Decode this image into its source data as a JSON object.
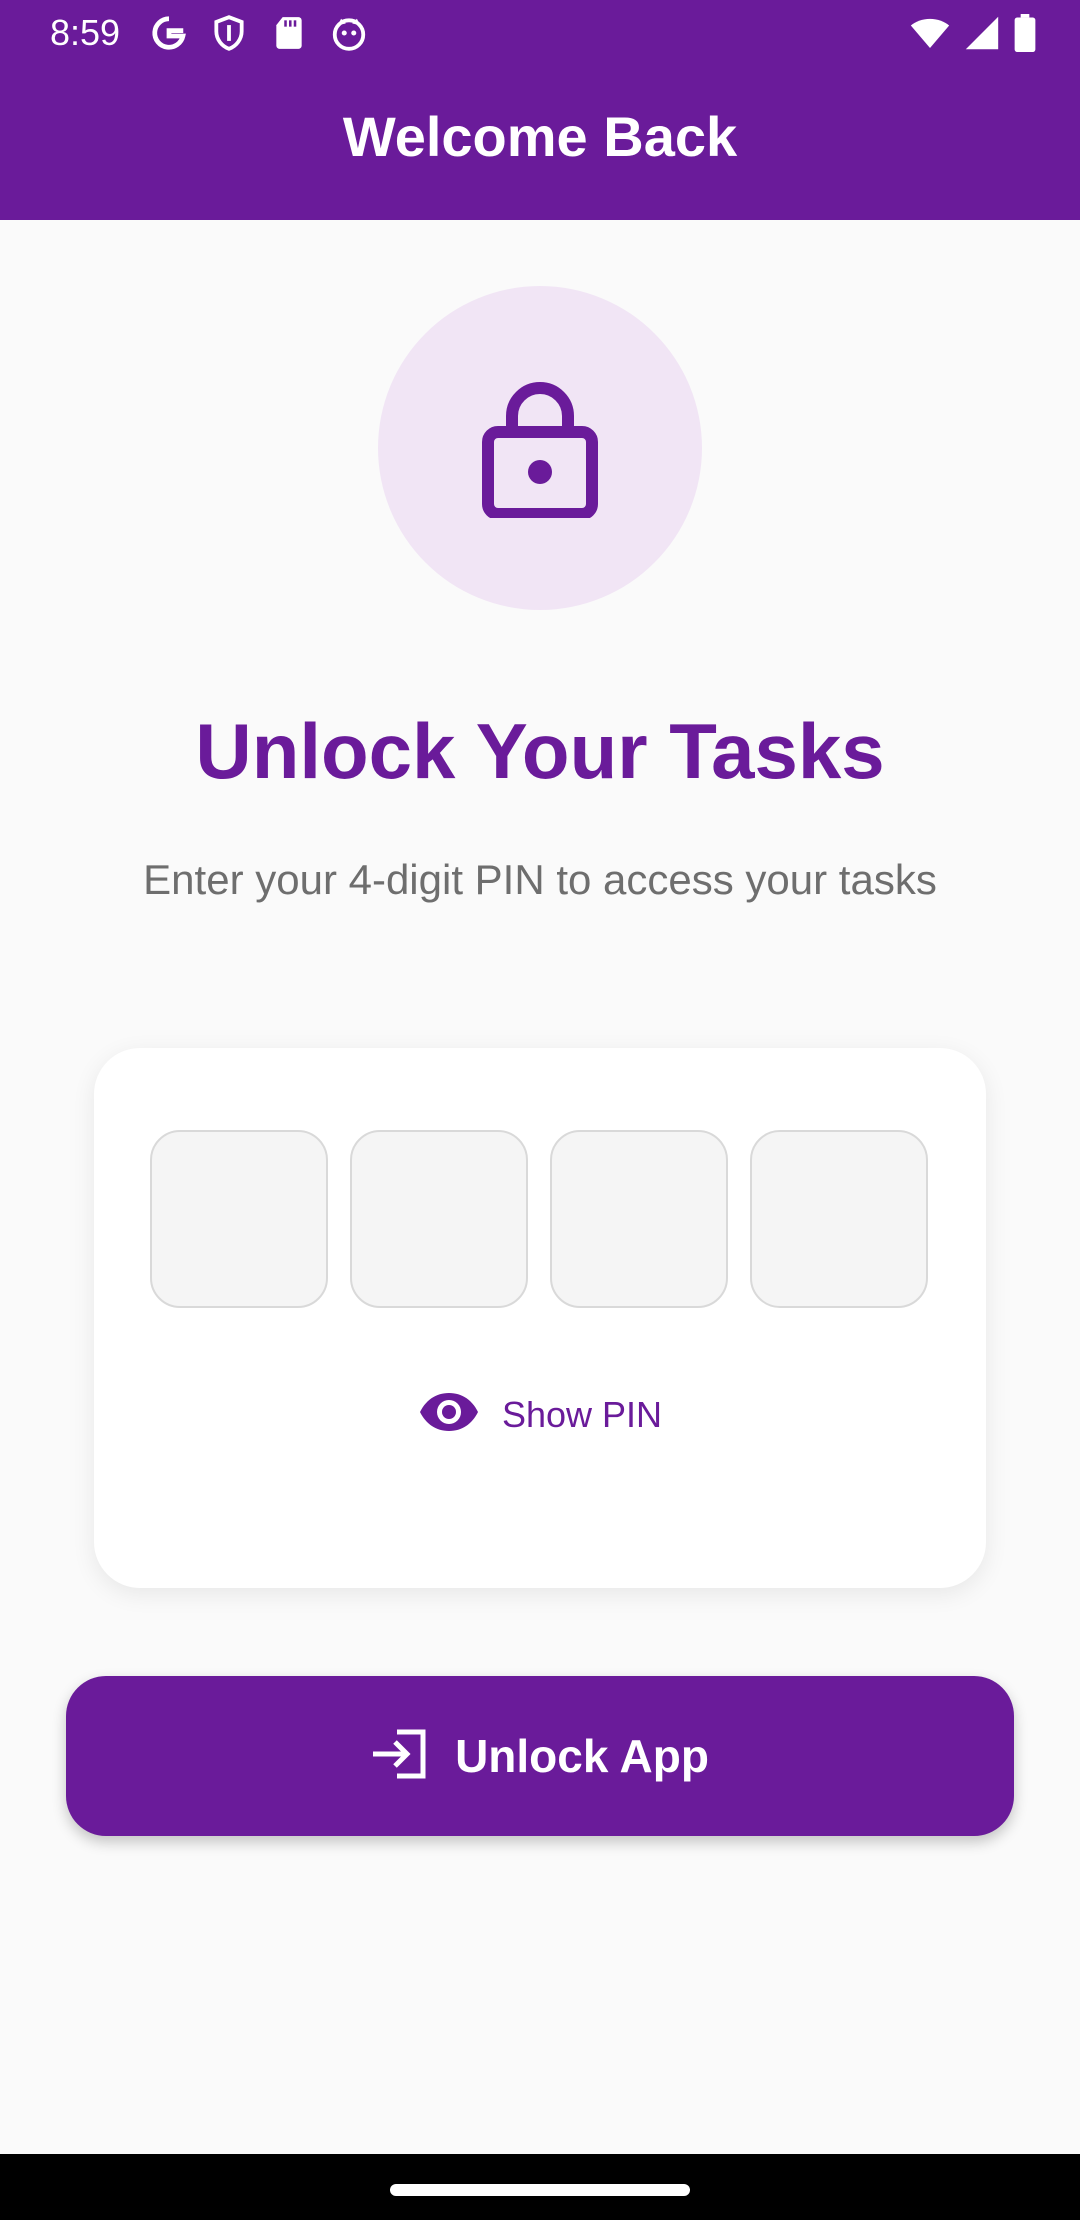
{
  "status_bar": {
    "time": "8:59",
    "left_icons": [
      "google-icon",
      "shield-icon",
      "sd-card-icon",
      "cat-face-icon"
    ],
    "right_icons": [
      "wifi-icon",
      "signal-icon",
      "battery-icon"
    ]
  },
  "app_bar": {
    "title": "Welcome Back"
  },
  "lock_badge": {
    "icon": "lock-icon"
  },
  "heading": "Unlock Your Tasks",
  "subheading": "Enter your 4-digit PIN to access your tasks",
  "pin_card": {
    "digits": [
      "",
      "",
      "",
      ""
    ],
    "show_pin_label": "Show PIN"
  },
  "unlock_button": {
    "label": "Unlock App",
    "icon": "login-icon"
  },
  "colors": {
    "primary": "#6A1B9A",
    "badge_bg": "#F1E5F5",
    "background": "#FAFAFA",
    "subtext": "#6E6E6E"
  }
}
